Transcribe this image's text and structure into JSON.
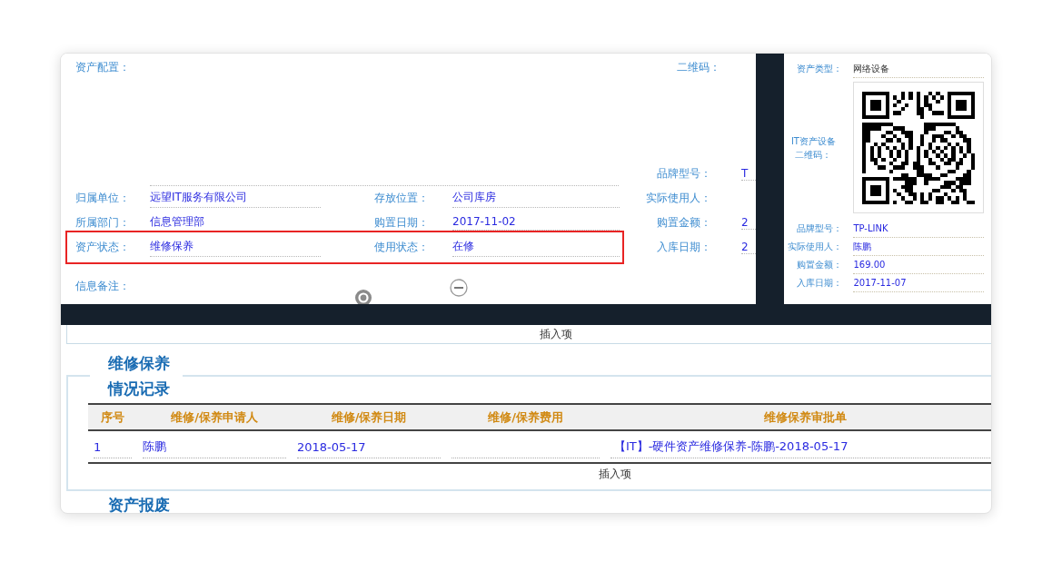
{
  "form": {
    "config_label": "资产配置：",
    "qr_label": "二维码：",
    "rows": [
      {
        "label": "归属单位：",
        "value": "远望IT服务有限公司",
        "label2": "存放位置：",
        "value2": "公司库房",
        "highlighted": false
      },
      {
        "label": "所属部门：",
        "value": "信息管理部",
        "label2": "购置日期：",
        "value2": "2017-11-02",
        "highlighted": false
      },
      {
        "label": "资产状态：",
        "value": "维修保养",
        "label2": "使用状态：",
        "value2": "在修",
        "highlighted": true
      }
    ],
    "side_fields": [
      {
        "label": "品牌型号：",
        "value": "T"
      },
      {
        "label": "实际使用人："
      },
      {
        "label": "购置金额：",
        "value": "2"
      },
      {
        "label": "入库日期：",
        "value": "2"
      }
    ],
    "note_label": "信息备注："
  },
  "detail_panel": {
    "type_label": "资产类型：",
    "type_value": "网络设备",
    "qr_label": "IT资产设备二维码：",
    "fields": [
      {
        "label": "品牌型号：",
        "value": "TP-LINK"
      },
      {
        "label": "实际使用人：",
        "value": "陈鹏"
      },
      {
        "label": "购置金额：",
        "value": "169.00"
      },
      {
        "label": "入库日期：",
        "value": "2017-11-07"
      }
    ]
  },
  "insert_item": "插入项",
  "maintenance": {
    "title": "维修保养情况记录",
    "columns": [
      "序号",
      "维修/保养申请人",
      "维修/保养日期",
      "维修/保养费用",
      "维修保养审批单"
    ],
    "rows": [
      {
        "cells": [
          "1",
          "陈鹏",
          "2018-05-17",
          null,
          "【IT】-硬件资产维修保养-陈鹏-2018-05-17"
        ]
      }
    ],
    "insert_item": "插入项"
  },
  "next_section": {
    "title": "资产报废"
  }
}
